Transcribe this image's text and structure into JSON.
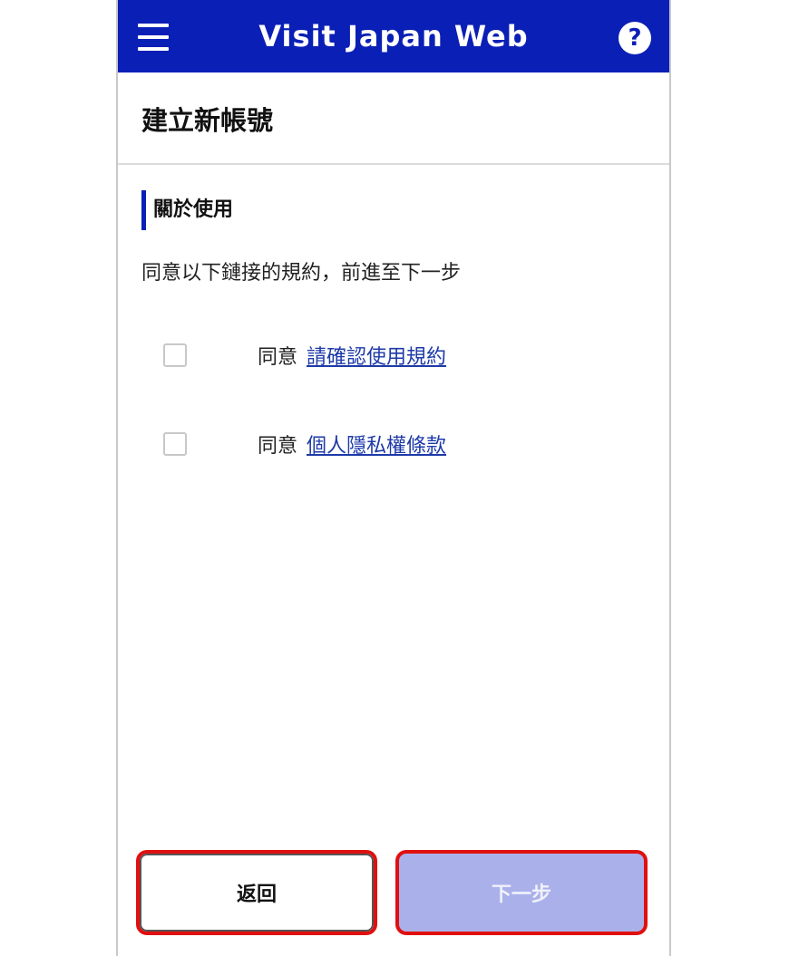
{
  "app_bar": {
    "title": "Visit Japan Web",
    "menu_icon": "hamburger-menu-icon",
    "help_icon": "question-circle-icon",
    "help_glyph": "?",
    "color": "#0a1fb5"
  },
  "page": {
    "title": "建立新帳號"
  },
  "section": {
    "title": "關於使用",
    "instruction": "同意以下鏈接的規約，前進至下一步"
  },
  "agreements": [
    {
      "prefix": "同意",
      "link": "請確認使用規約",
      "checked": false
    },
    {
      "prefix": "同意",
      "link": "個人隱私權條款",
      "checked": false
    }
  ],
  "buttons": {
    "back": "返回",
    "next": "下一步",
    "highlight_color": "#e01010"
  }
}
